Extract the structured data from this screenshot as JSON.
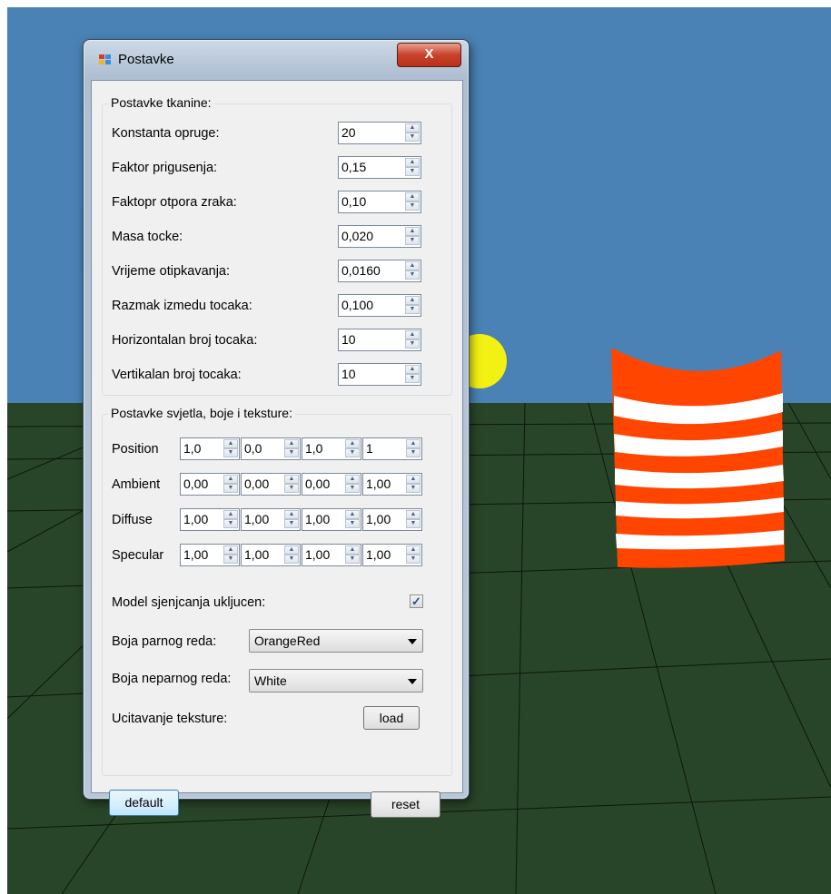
{
  "window": {
    "title": "Postavke",
    "close_label": "X"
  },
  "cloth_group": {
    "title": "Postavke tkanine:",
    "rows": [
      {
        "label": "Konstanta opruge:",
        "value": "20"
      },
      {
        "label": "Faktor prigusenja:",
        "value": "0,15"
      },
      {
        "label": "Faktopr otpora zraka:",
        "value": "0,10"
      },
      {
        "label": "Masa tocke:",
        "value": "0,020"
      },
      {
        "label": "Vrijeme otipkavanja:",
        "value": "0,0160"
      },
      {
        "label": "Razmak izmedu tocaka:",
        "value": "0,100"
      },
      {
        "label": "Horizontalan broj tocaka:",
        "value": "10"
      },
      {
        "label": "Vertikalan broj tocaka:",
        "value": "10"
      }
    ]
  },
  "light_group": {
    "title": "Postavke svjetla, boje i teksture:",
    "rows": [
      {
        "label": "Position",
        "values": [
          "1,0",
          "0,0",
          "1,0",
          "1"
        ]
      },
      {
        "label": "Ambient",
        "values": [
          "0,00",
          "0,00",
          "0,00",
          "1,00"
        ]
      },
      {
        "label": "Diffuse",
        "values": [
          "1,00",
          "1,00",
          "1,00",
          "1,00"
        ]
      },
      {
        "label": "Specular",
        "values": [
          "1,00",
          "1,00",
          "1,00",
          "1,00"
        ]
      }
    ],
    "shading_label": "Model sjenjcanja ukljucen:",
    "shading_checked": true,
    "even_row_label": "Boja parnog reda:",
    "even_row_value": "OrangeRed",
    "odd_row_label": "Boja neparnog reda:",
    "odd_row_value": "White",
    "texture_label": "Ucitavanje teksture:",
    "load_label": "load"
  },
  "buttons": {
    "default_label": "default",
    "reset_label": "reset"
  },
  "colors": {
    "sky": "#4a82b5",
    "ground": "#294529",
    "grid": "#0c160c",
    "sun": "#f3f013",
    "stripe_a": "#ff4500",
    "stripe_b": "#ffffff"
  }
}
